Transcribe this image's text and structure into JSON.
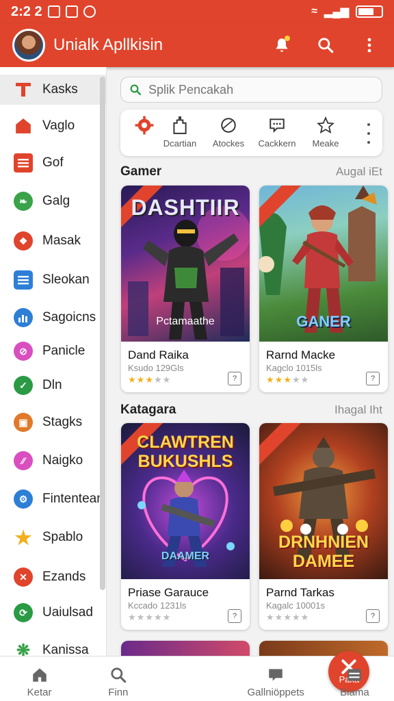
{
  "status_bar": {
    "time": "2:2 2"
  },
  "app_bar": {
    "title": "Unialk Apllkisin"
  },
  "sidebar": {
    "items": [
      {
        "label": "Kasks",
        "icon": "kasks-icon",
        "color": "#e0442c"
      },
      {
        "label": "Vaglo",
        "icon": "house-icon",
        "color": "#e0442c"
      },
      {
        "label": "Gof",
        "icon": "list-icon",
        "color": "#e0442c"
      },
      {
        "label": "Galg",
        "icon": "leaf-icon",
        "color": "#3aa34a"
      },
      {
        "label": "Masak",
        "icon": "target-icon",
        "color": "#e0442c"
      },
      {
        "label": "Sleokan",
        "icon": "menu-icon",
        "color": "#2d7fd6"
      },
      {
        "label": "Sagoicns",
        "icon": "chart-icon",
        "color": "#2d7fd6"
      },
      {
        "label": "Panicle",
        "icon": "no-icon",
        "color": "#d94fbf"
      },
      {
        "label": "Dln",
        "icon": "check-icon",
        "color": "#2a9a45"
      },
      {
        "label": "Stagks",
        "icon": "bag-icon",
        "color": "#e07a2a"
      },
      {
        "label": "Naigko",
        "icon": "stripes-icon",
        "color": "#d94fbf"
      },
      {
        "label": "Fintentean",
        "icon": "gear-icon",
        "color": "#2d7fd6"
      },
      {
        "label": "Spablo",
        "icon": "star-icon",
        "color": "#f2b01e"
      },
      {
        "label": "Ezands",
        "icon": "x-icon",
        "color": "#e0442c"
      },
      {
        "label": "Uaiulsad",
        "icon": "refresh-icon",
        "color": "#2a9a45"
      },
      {
        "label": "Kanissa",
        "icon": "plant-icon",
        "color": "#3aa34a"
      }
    ]
  },
  "search": {
    "placeholder": "Splik Pencakah"
  },
  "categories": [
    {
      "label": "Dcartian",
      "icon": "gear-icon"
    },
    {
      "label": "Atockes",
      "icon": "building-icon"
    },
    {
      "label": "Cackkern",
      "icon": "ball-icon"
    },
    {
      "label": "Meake",
      "icon": "chat-icon"
    },
    {
      "label": "",
      "icon": "star-icon"
    }
  ],
  "sections": [
    {
      "title": "Gamer",
      "link": "Augal iEt",
      "cards": [
        {
          "name": "Dand Raika",
          "meta": "Ksudo 129Gls",
          "rating": 3,
          "art_title": "DASHTIIR",
          "art_caption": "Pctamaathe",
          "badge": "7Sa"
        },
        {
          "name": "Rarnd Macke",
          "meta": "Kagclo 1015ls",
          "rating": 3,
          "art_title": "GANER",
          "art_caption": "",
          "badge": "7Sa"
        }
      ]
    },
    {
      "title": "Katagara",
      "link": "Ihagal Iht",
      "cards": [
        {
          "name": "Priase Garauce",
          "meta": "Kccado 1231ls",
          "rating": 0,
          "art_title": "CLAWTREN BUKUSHLS",
          "art_caption": "DAAMER",
          "badge": "7Sa"
        },
        {
          "name": "Parnd Tarkas",
          "meta": "Kagalc 10001s",
          "rating": 0,
          "art_title": "DRNHNIEN DAMEE",
          "art_caption": "",
          "badge": "7Sa"
        }
      ]
    }
  ],
  "bottom_nav": [
    {
      "label": "Ketar",
      "icon": "home-icon"
    },
    {
      "label": "Finn",
      "icon": "search-icon"
    },
    {
      "label": "Paka",
      "icon": "center-x-icon"
    },
    {
      "label": "Gallniöppets",
      "icon": "chat-icon"
    },
    {
      "label": "Biama",
      "icon": "list-icon"
    }
  ],
  "colors": {
    "primary": "#e0442c",
    "background": "#f2f2f2",
    "card": "#ffffff",
    "star": "#f2b01e"
  }
}
